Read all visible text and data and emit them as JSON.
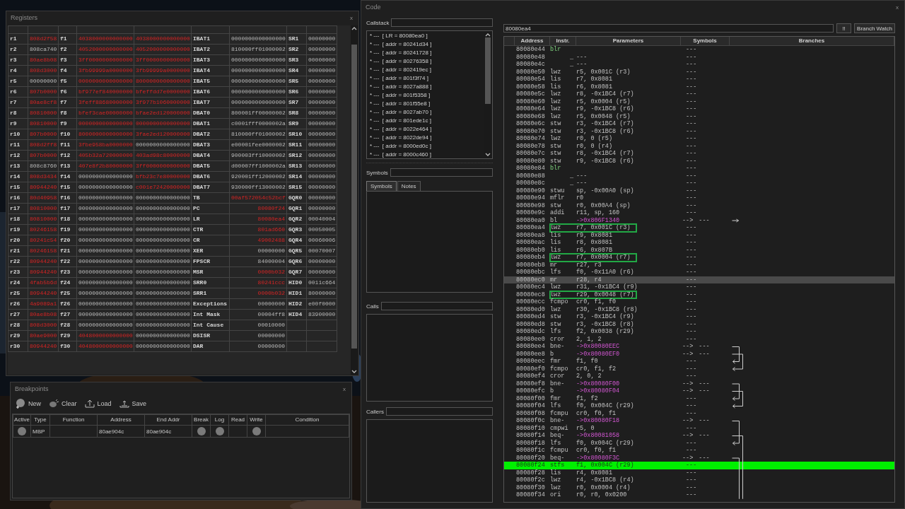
{
  "registers_window": {
    "title": "Registers",
    "close": "x",
    "rows": [
      {
        "gpr": "r1",
        "gpr_value": "808d2f58",
        "gpr_changed": true,
        "fpr": "f1",
        "ps0": "4038000000000000",
        "ps0_changed": true,
        "ps1": "4038000000000000",
        "ps1_changed": true,
        "spr": "IBAT1",
        "spr_value": "0000000000000000",
        "spr_changed": false,
        "sr": "SR1",
        "sr_value": "00000000",
        "sr_changed": false
      },
      {
        "gpr": "r2",
        "gpr_value": "808ca740",
        "gpr_changed": false,
        "fpr": "f2",
        "ps0": "4052000000000000",
        "ps0_changed": true,
        "ps1": "4052000000000000",
        "ps1_changed": true,
        "spr": "IBAT2",
        "spr_value": "810000ff01000002",
        "spr_changed": false,
        "sr": "SR2",
        "sr_value": "00000000",
        "sr_changed": false
      },
      {
        "gpr": "r3",
        "gpr_value": "80ae8b08",
        "gpr_changed": true,
        "fpr": "f3",
        "ps0": "3ff0000000000000",
        "ps0_changed": true,
        "ps1": "3ff0000000000000",
        "ps1_changed": true,
        "spr": "IBAT3",
        "spr_value": "0000000000000000",
        "spr_changed": false,
        "sr": "SR3",
        "sr_value": "00000000",
        "sr_changed": false
      },
      {
        "gpr": "r4",
        "gpr_value": "808d3000",
        "gpr_changed": true,
        "fpr": "f4",
        "ps0": "3fb99999a0000000",
        "ps0_changed": true,
        "ps1": "3fb99999a0000000",
        "ps1_changed": true,
        "spr": "IBAT4",
        "spr_value": "0000000000000000",
        "spr_changed": false,
        "sr": "SR4",
        "sr_value": "00000000",
        "sr_changed": false
      },
      {
        "gpr": "r5",
        "gpr_value": "00000000",
        "gpr_changed": false,
        "fpr": "f5",
        "ps0": "0000000000000000",
        "ps0_changed": true,
        "ps1": "8000000000000000",
        "ps1_changed": true,
        "spr": "IBAT5",
        "spr_value": "0000000000000000",
        "spr_changed": false,
        "sr": "SR5",
        "sr_value": "00000000",
        "sr_changed": false
      },
      {
        "gpr": "r6",
        "gpr_value": "807b0000",
        "gpr_changed": true,
        "fpr": "f6",
        "ps0": "bf977ef840000000",
        "ps0_changed": true,
        "ps1": "bfeffdd7e0000000",
        "ps1_changed": true,
        "spr": "IBAT6",
        "spr_value": "0000000000000000",
        "spr_changed": false,
        "sr": "SR6",
        "sr_value": "00000000",
        "sr_changed": false
      },
      {
        "gpr": "r7",
        "gpr_value": "80ae8cf8",
        "gpr_changed": true,
        "fpr": "f7",
        "ps0": "3feff88680000000",
        "ps0_changed": true,
        "ps1": "3f977b1060000000",
        "ps1_changed": true,
        "spr": "IBAT7",
        "spr_value": "0000000000000000",
        "spr_changed": false,
        "sr": "SR7",
        "sr_value": "00000000",
        "sr_changed": false
      },
      {
        "gpr": "r8",
        "gpr_value": "80810000",
        "gpr_changed": true,
        "fpr": "f8",
        "ps0": "bfef3cae00000000",
        "ps0_changed": true,
        "ps1": "bfae2ed120000000",
        "ps1_changed": true,
        "spr": "DBAT0",
        "spr_value": "800001ff00000002",
        "spr_changed": false,
        "sr": "SR8",
        "sr_value": "00000000",
        "sr_changed": false
      },
      {
        "gpr": "r9",
        "gpr_value": "80810000",
        "gpr_changed": true,
        "fpr": "f9",
        "ps0": "0000000000000000",
        "ps0_changed": true,
        "ps1": "0000000000000000",
        "ps1_changed": true,
        "spr": "DBAT1",
        "spr_value": "c0001fff0000002a",
        "spr_changed": false,
        "sr": "SR9",
        "sr_value": "00000000",
        "sr_changed": false
      },
      {
        "gpr": "r10",
        "gpr_value": "807b0000",
        "gpr_changed": true,
        "fpr": "f10",
        "ps0": "8000000000000000",
        "ps0_changed": true,
        "ps1": "3fae2ed120000000",
        "ps1_changed": true,
        "spr": "DBAT2",
        "spr_value": "810000ff01000002",
        "spr_changed": false,
        "sr": "SR10",
        "sr_value": "00000000",
        "sr_changed": false
      },
      {
        "gpr": "r11",
        "gpr_value": "808d2ff8",
        "gpr_changed": true,
        "fpr": "f11",
        "ps0": "3fbe958ba0000000",
        "ps0_changed": true,
        "ps1": "0000000000000000",
        "ps1_changed": false,
        "spr": "DBAT3",
        "spr_value": "e00001fee0000002",
        "spr_changed": false,
        "sr": "SR11",
        "sr_value": "00000000",
        "sr_changed": false
      },
      {
        "gpr": "r12",
        "gpr_value": "807b0000",
        "gpr_changed": true,
        "fpr": "f12",
        "ps0": "405b32a720000000",
        "ps0_changed": true,
        "ps1": "403ad98c80000000",
        "ps1_changed": true,
        "spr": "DBAT4",
        "spr_value": "900003ff10000002",
        "spr_changed": false,
        "sr": "SR12",
        "sr_value": "00000000",
        "sr_changed": false
      },
      {
        "gpr": "r13",
        "gpr_value": "808c8760",
        "gpr_changed": false,
        "fpr": "f13",
        "ps0": "407e8f2b80000000",
        "ps0_changed": true,
        "ps1": "3ff0000000000000",
        "ps1_changed": true,
        "spr": "DBAT5",
        "spr_value": "d00007ff1000002a",
        "spr_changed": false,
        "sr": "SR13",
        "sr_value": "00000000",
        "sr_changed": false
      },
      {
        "gpr": "r14",
        "gpr_value": "808d3434",
        "gpr_changed": true,
        "fpr": "f14",
        "ps0": "0000000000000000",
        "ps0_changed": false,
        "ps1": "bfb23c7e80000000",
        "ps1_changed": true,
        "spr": "DBAT6",
        "spr_value": "920001ff12000002",
        "spr_changed": false,
        "sr": "SR14",
        "sr_value": "00000000",
        "sr_changed": false
      },
      {
        "gpr": "r15",
        "gpr_value": "80944240",
        "gpr_changed": true,
        "fpr": "f15",
        "ps0": "0000000000000000",
        "ps0_changed": false,
        "ps1": "c001e72420000000",
        "ps1_changed": true,
        "spr": "DBAT7",
        "spr_value": "930000ff13000002",
        "spr_changed": false,
        "sr": "SR15",
        "sr_value": "00000000",
        "sr_changed": false
      },
      {
        "gpr": "r16",
        "gpr_value": "80d40958",
        "gpr_changed": true,
        "fpr": "f16",
        "ps0": "0000000000000000",
        "ps0_changed": false,
        "ps1": "0000000000000000",
        "ps1_changed": false,
        "spr": "TB",
        "spr_value": "00af572054c52bcf",
        "spr_changed": true,
        "sr": "GQR0",
        "sr_value": "00000000",
        "sr_changed": false
      },
      {
        "gpr": "r17",
        "gpr_value": "80810000",
        "gpr_changed": true,
        "fpr": "f17",
        "ps0": "0000000000000000",
        "ps0_changed": false,
        "ps1": "0000000000000000",
        "ps1_changed": false,
        "spr": "PC",
        "spr_value": "80080f24",
        "spr_changed": true,
        "sr": "GQR1",
        "sr_value": "00000000",
        "sr_changed": false
      },
      {
        "gpr": "r18",
        "gpr_value": "80810000",
        "gpr_changed": true,
        "fpr": "f18",
        "ps0": "0000000000000000",
        "ps0_changed": false,
        "ps1": "0000000000000000",
        "ps1_changed": false,
        "spr": "LR",
        "spr_value": "80080ea4",
        "spr_changed": true,
        "sr": "GQR2",
        "sr_value": "00040004",
        "sr_changed": false
      },
      {
        "gpr": "r19",
        "gpr_value": "80246158",
        "gpr_changed": true,
        "fpr": "f19",
        "ps0": "0000000000000000",
        "ps0_changed": false,
        "ps1": "0000000000000000",
        "ps1_changed": false,
        "spr": "CTR",
        "spr_value": "801ad660",
        "spr_changed": true,
        "sr": "GQR3",
        "sr_value": "00050005",
        "sr_changed": false
      },
      {
        "gpr": "r20",
        "gpr_value": "80241c54",
        "gpr_changed": true,
        "fpr": "f20",
        "ps0": "0000000000000000",
        "ps0_changed": false,
        "ps1": "0000000000000000",
        "ps1_changed": false,
        "spr": "CR",
        "spr_value": "49002488",
        "spr_changed": true,
        "sr": "GQR4",
        "sr_value": "00060006",
        "sr_changed": false
      },
      {
        "gpr": "r21",
        "gpr_value": "80246158",
        "gpr_changed": true,
        "fpr": "f21",
        "ps0": "0000000000000000",
        "ps0_changed": false,
        "ps1": "0000000000000000",
        "ps1_changed": false,
        "spr": "XER",
        "spr_value": "00000000",
        "spr_changed": false,
        "sr": "GQR5",
        "sr_value": "00070007",
        "sr_changed": false
      },
      {
        "gpr": "r22",
        "gpr_value": "80944240",
        "gpr_changed": true,
        "fpr": "f22",
        "ps0": "0000000000000000",
        "ps0_changed": false,
        "ps1": "0000000000000000",
        "ps1_changed": false,
        "spr": "FPSCR",
        "spr_value": "84000004",
        "spr_changed": false,
        "sr": "GQR6",
        "sr_value": "00000000",
        "sr_changed": false
      },
      {
        "gpr": "r23",
        "gpr_value": "80944240",
        "gpr_changed": true,
        "fpr": "f23",
        "ps0": "0000000000000000",
        "ps0_changed": false,
        "ps1": "0000000000000000",
        "ps1_changed": false,
        "spr": "MSR",
        "spr_value": "0000b032",
        "spr_changed": true,
        "sr": "GQR7",
        "sr_value": "00000000",
        "sr_changed": false
      },
      {
        "gpr": "r24",
        "gpr_value": "4fab5b6d",
        "gpr_changed": true,
        "fpr": "f24",
        "ps0": "0000000000000000",
        "ps0_changed": false,
        "ps1": "0000000000000000",
        "ps1_changed": false,
        "spr": "SRR0",
        "spr_value": "80241ccc",
        "spr_changed": true,
        "sr": "HID0",
        "sr_value": "0011c664",
        "sr_changed": false
      },
      {
        "gpr": "r25",
        "gpr_value": "80944240",
        "gpr_changed": true,
        "fpr": "f25",
        "ps0": "0000000000000000",
        "ps0_changed": false,
        "ps1": "0000000000000000",
        "ps1_changed": false,
        "spr": "SRR1",
        "spr_value": "0000b032",
        "spr_changed": true,
        "sr": "HID1",
        "sr_value": "80000000",
        "sr_changed": false
      },
      {
        "gpr": "r26",
        "gpr_value": "4a9089a1",
        "gpr_changed": true,
        "fpr": "f26",
        "ps0": "0000000000000000",
        "ps0_changed": false,
        "ps1": "0000000000000000",
        "ps1_changed": false,
        "spr": "Exceptions",
        "spr_value": "00000000",
        "spr_changed": false,
        "sr": "HID2",
        "sr_value": "e00f0000",
        "sr_changed": false
      },
      {
        "gpr": "r27",
        "gpr_value": "80ae8b08",
        "gpr_changed": true,
        "fpr": "f27",
        "ps0": "0000000000000000",
        "ps0_changed": false,
        "ps1": "0000000000000000",
        "ps1_changed": false,
        "spr": "Int Mask",
        "spr_value": "00004ff8",
        "spr_changed": false,
        "sr": "HID4",
        "sr_value": "83900000",
        "sr_changed": false
      },
      {
        "gpr": "r28",
        "gpr_value": "808d3000",
        "gpr_changed": true,
        "fpr": "f28",
        "ps0": "0000000000000000",
        "ps0_changed": false,
        "ps1": "0000000000000000",
        "ps1_changed": false,
        "spr": "Int Cause",
        "spr_value": "00010000",
        "spr_changed": false
      },
      {
        "gpr": "r29",
        "gpr_value": "80ae9000",
        "gpr_changed": true,
        "fpr": "f29",
        "ps0": "4048000000000000",
        "ps0_changed": true,
        "ps1": "0000000000000000",
        "ps1_changed": false,
        "spr": "DSISR",
        "spr_value": "00000000",
        "spr_changed": false
      },
      {
        "gpr": "r30",
        "gpr_value": "80944240",
        "gpr_changed": true,
        "fpr": "f30",
        "ps0": "4048000000000000",
        "ps0_changed": true,
        "ps1": "0000000000000000",
        "ps1_changed": false,
        "spr": "DAR",
        "spr_value": "00000000",
        "spr_changed": false
      }
    ]
  },
  "breakpoints_window": {
    "title": "Breakpoints",
    "close": "x",
    "tools": [
      {
        "label": "New",
        "kind": "new"
      },
      {
        "label": "Clear",
        "kind": "clear"
      },
      {
        "label": "Load",
        "kind": "load"
      },
      {
        "label": "Save",
        "kind": "save"
      }
    ],
    "columns": [
      "Active",
      "Type",
      "Function",
      "Address",
      "End Addr",
      "Break",
      "Log",
      "Read",
      "Write",
      "Condition"
    ],
    "rows": [
      {
        "active": false,
        "type": "MBP",
        "address": "80ae904c",
        "end_addr": "80ae904c",
        "break": false,
        "log": false,
        "write": false
      }
    ]
  },
  "code_window": {
    "title": "Code",
    "close": "x",
    "callstack": {
      "label": "Callstack",
      "items": [
        "* ---  [ LR = 80080ea0 ]",
        "* ---  [ addr = 80241d34 ]",
        "* ---  [ addr = 80241728 ]",
        "* ---  [ addr = 80276358 ]",
        "* ---  [ addr = 802419ec ]",
        "* ---  [ addr = 801f3f74 ]",
        "* ---  [ addr = 8027a888 ]",
        "* ---  [ addr = 801f5358 ]",
        "* ---  [ addr = 801f55e8 ]",
        "* ---  [ addr = 8027ab70 ]",
        "* ---  [ addr = 801ede1c ]",
        "* ---  [ addr = 8022e464 ]",
        "* ---  [ addr = 8022de94 ]",
        "* ---  [ addr = 8000ed0c ]",
        "* ---  [ addr = 8000c460 ]"
      ]
    },
    "symbols": {
      "label": "Symbols",
      "tabs": [
        {
          "label": "Symbols",
          "selected": true
        },
        {
          "label": "Notes",
          "selected": false
        }
      ]
    },
    "calls": {
      "label": "Calls"
    },
    "callers": {
      "label": "Callers"
    },
    "search": {
      "value": "80080ea4"
    },
    "buttons": [
      "!!",
      "Branch Watch"
    ],
    "columns": [
      "Address",
      "Instr.",
      "Parameters",
      "Symbols",
      "Branches"
    ],
    "rows": [
      {
        "address": "80080e44",
        "instr": "blr",
        "kind": "return",
        "symbol": "---"
      },
      {
        "address": "80080e48",
        "instr": "_",
        "params": "---",
        "kind": "blank",
        "symbol": "---"
      },
      {
        "address": "80080e4c",
        "instr": "_",
        "params": "---",
        "kind": "blank",
        "symbol": "---"
      },
      {
        "address": "80080e50",
        "instr": "lwz",
        "params": "r5, 0x001C (r3)",
        "kind": "op",
        "symbol": "---"
      },
      {
        "address": "80080e54",
        "instr": "lis",
        "params": "r7, 0x8081",
        "kind": "op",
        "symbol": "---"
      },
      {
        "address": "80080e58",
        "instr": "lis",
        "params": "r6, 0x8081",
        "kind": "op",
        "symbol": "---"
      },
      {
        "address": "80080e5c",
        "instr": "lwz",
        "params": "r8, -0x1BC4 (r7)",
        "kind": "op",
        "symbol": "---"
      },
      {
        "address": "80080e60",
        "instr": "lwz",
        "params": "r5, 0x0004 (r5)",
        "kind": "op",
        "symbol": "---"
      },
      {
        "address": "80080e64",
        "instr": "lwz",
        "params": "r9, -0x1BC8 (r6)",
        "kind": "op",
        "symbol": "---"
      },
      {
        "address": "80080e68",
        "instr": "lwz",
        "params": "r5, 0x0048 (r5)",
        "kind": "op",
        "symbol": "---"
      },
      {
        "address": "80080e6c",
        "instr": "stw",
        "params": "r3, -0x1BC4 (r7)",
        "kind": "op",
        "symbol": "---"
      },
      {
        "address": "80080e70",
        "instr": "stw",
        "params": "r3, -0x1BC8 (r6)",
        "kind": "op",
        "symbol": "---"
      },
      {
        "address": "80080e74",
        "instr": "lwz",
        "params": "r0, 0 (r5)",
        "kind": "op",
        "symbol": "---"
      },
      {
        "address": "80080e78",
        "instr": "stw",
        "params": "r0, 0 (r4)",
        "kind": "op",
        "symbol": "---"
      },
      {
        "address": "80080e7c",
        "instr": "stw",
        "params": "r8, -0x1BC4 (r7)",
        "kind": "op",
        "symbol": "---"
      },
      {
        "address": "80080e80",
        "instr": "stw",
        "params": "r9, -0x1BC8 (r6)",
        "kind": "op",
        "symbol": "---"
      },
      {
        "address": "80080e84",
        "instr": "blr",
        "kind": "return",
        "symbol": "---"
      },
      {
        "address": "80080e88",
        "instr": "_",
        "params": "---",
        "kind": "blank",
        "symbol": "---"
      },
      {
        "address": "80080e8c",
        "instr": "_",
        "params": "---",
        "kind": "blank",
        "symbol": "---"
      },
      {
        "address": "80080e90",
        "instr": "stwu",
        "params": "sp, -0x00A0 (sp)",
        "kind": "op",
        "symbol": "---"
      },
      {
        "address": "80080e94",
        "instr": "mflr",
        "params": "r0",
        "kind": "op",
        "symbol": "---"
      },
      {
        "address": "80080e98",
        "instr": "stw",
        "params": "r0, 0x00A4 (sp)",
        "kind": "op",
        "symbol": "---"
      },
      {
        "address": "80080e9c",
        "instr": "addi",
        "params": "r11, sp, 160",
        "kind": "op",
        "symbol": "---"
      },
      {
        "address": "80080ea0",
        "instr": "bl",
        "params": "->0x806F1340",
        "kind": "call",
        "link": "-->",
        "symbol": "---"
      },
      {
        "address": "80080ea4",
        "instr": "lwz",
        "params": "r7, 0x001C (r3)",
        "kind": "op",
        "symbol": "---",
        "marked": true
      },
      {
        "address": "80080ea8",
        "instr": "lis",
        "params": "r9, 0x8081",
        "kind": "op",
        "symbol": "---"
      },
      {
        "address": "80080eac",
        "instr": "lis",
        "params": "r8, 0x8081",
        "kind": "op",
        "symbol": "---"
      },
      {
        "address": "80080eb0",
        "instr": "lis",
        "params": "r6, 0x807B",
        "kind": "op",
        "symbol": "---"
      },
      {
        "address": "80080eb4",
        "instr": "lwz",
        "params": "r7, 0x0004 (r7)",
        "kind": "op",
        "symbol": "---",
        "marked": true
      },
      {
        "address": "80080eb8",
        "instr": "mr",
        "params": "r27, r3",
        "kind": "op",
        "symbol": "---"
      },
      {
        "address": "80080ebc",
        "instr": "lfs",
        "params": "f0, -0x11A0 (r6)",
        "kind": "op",
        "symbol": "---"
      },
      {
        "address": "80080ec0",
        "instr": "mr",
        "params": "r28, r4",
        "kind": "op",
        "symbol": "---",
        "selected": true
      },
      {
        "address": "80080ec4",
        "instr": "lwz",
        "params": "r31, -0x1BC4 (r9)",
        "kind": "op",
        "symbol": "---"
      },
      {
        "address": "80080ec8",
        "instr": "lwz",
        "params": "r29, 0x0048 (r7)",
        "kind": "op",
        "symbol": "---",
        "marked": true
      },
      {
        "address": "80080ecc",
        "instr": "fcmpo",
        "params": "cr0, f1, f0",
        "kind": "op",
        "symbol": "---"
      },
      {
        "address": "80080ed0",
        "instr": "lwz",
        "params": "r30, -0x1BC8 (r8)",
        "kind": "op",
        "symbol": "---"
      },
      {
        "address": "80080ed4",
        "instr": "stw",
        "params": "r3, -0x1BC4 (r9)",
        "kind": "op",
        "symbol": "---"
      },
      {
        "address": "80080ed8",
        "instr": "stw",
        "params": "r3, -0x1BC8 (r8)",
        "kind": "op",
        "symbol": "---"
      },
      {
        "address": "80080edc",
        "instr": "lfs",
        "params": "f2, 0x0038 (r29)",
        "kind": "op",
        "symbol": "---"
      },
      {
        "address": "80080ee0",
        "instr": "cror",
        "params": "2, 1, 2",
        "kind": "op",
        "symbol": "---"
      },
      {
        "address": "80080ee4",
        "instr": "bne-",
        "params": "->0x80080EEC",
        "kind": "branch",
        "link": "-->",
        "symbol": "---"
      },
      {
        "address": "80080ee8",
        "instr": "b",
        "params": "->0x80080EF0",
        "kind": "branch",
        "link": "-->",
        "symbol": "---"
      },
      {
        "address": "80080eec",
        "instr": "fmr",
        "params": "f1, f0",
        "kind": "op",
        "symbol": "---"
      },
      {
        "address": "80080ef0",
        "instr": "fcmpo",
        "params": "cr0, f1, f2",
        "kind": "op",
        "symbol": "---"
      },
      {
        "address": "80080ef4",
        "instr": "cror",
        "params": "2, 0, 2",
        "kind": "op",
        "symbol": "---"
      },
      {
        "address": "80080ef8",
        "instr": "bne-",
        "params": "->0x80080F00",
        "kind": "branch",
        "link": "-->",
        "symbol": "---"
      },
      {
        "address": "80080efc",
        "instr": "b",
        "params": "->0x80080F04",
        "kind": "branch",
        "link": "-->",
        "symbol": "---"
      },
      {
        "address": "80080f00",
        "instr": "fmr",
        "params": "f1, f2",
        "kind": "op",
        "symbol": "---"
      },
      {
        "address": "80080f04",
        "instr": "lfs",
        "params": "f0, 0x004C (r29)",
        "kind": "op",
        "symbol": "---"
      },
      {
        "address": "80080f08",
        "instr": "fcmpu",
        "params": "cr0, f0, f1",
        "kind": "op",
        "symbol": "---"
      },
      {
        "address": "80080f0c",
        "instr": "bne-",
        "params": "->0x80080F18",
        "kind": "branch",
        "link": "-->",
        "symbol": "---"
      },
      {
        "address": "80080f10",
        "instr": "cmpwi",
        "params": "r5, 0",
        "kind": "op",
        "symbol": "---"
      },
      {
        "address": "80080f14",
        "instr": "beq-",
        "params": "->0x80081058",
        "kind": "branch",
        "link": "-->",
        "symbol": "---"
      },
      {
        "address": "80080f18",
        "instr": "lfs",
        "params": "f0, 0x004C (r29)",
        "kind": "op",
        "symbol": "---"
      },
      {
        "address": "80080f1c",
        "instr": "fcmpu",
        "params": "cr0, f0, f1",
        "kind": "op",
        "symbol": "---"
      },
      {
        "address": "80080f20",
        "instr": "beq-",
        "params": "->0x80080F3C",
        "kind": "branch",
        "link": "-->",
        "symbol": "---"
      },
      {
        "address": "80080f24",
        "instr": "stfs",
        "params": "f1, 0x004C (r29)",
        "kind": "op",
        "symbol": "---",
        "current": true
      },
      {
        "address": "80080f28",
        "instr": "lis",
        "params": "r4, 0x8081",
        "kind": "op",
        "symbol": "---"
      },
      {
        "address": "80080f2c",
        "instr": "lwz",
        "params": "r4, -0x1BC8 (r4)",
        "kind": "op",
        "symbol": "---"
      },
      {
        "address": "80080f30",
        "instr": "lwz",
        "params": "r0, 0x0004 (r4)",
        "kind": "op",
        "symbol": "---"
      },
      {
        "address": "80080f34",
        "instr": "ori",
        "params": "r0, r0, 0x0200",
        "kind": "op",
        "symbol": "---"
      }
    ]
  }
}
